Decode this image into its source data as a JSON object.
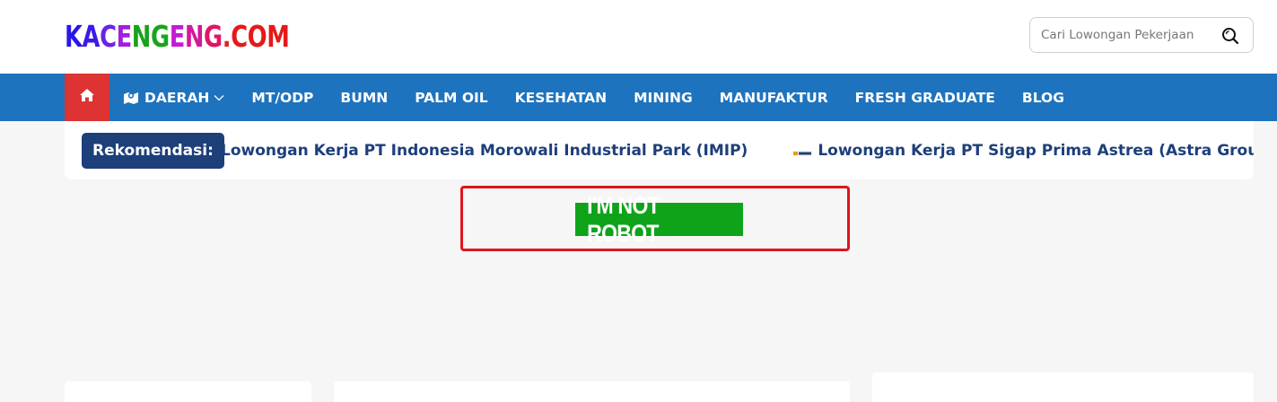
{
  "header": {
    "logo": {
      "letters": [
        {
          "ch": "K",
          "color": "#2a17e6"
        },
        {
          "ch": "A",
          "color": "#3d1ae8"
        },
        {
          "ch": "C",
          "color": "#6b22e8"
        },
        {
          "ch": "E",
          "color": "#a11fe0"
        },
        {
          "ch": "N",
          "color": "#18a21c"
        },
        {
          "ch": "G",
          "color": "#1aa41e"
        },
        {
          "ch": "E",
          "color": "#c51ad6"
        },
        {
          "ch": "N",
          "color": "#d4189a"
        },
        {
          "ch": "G",
          "color": "#e21563"
        },
        {
          "ch": ".",
          "color": "#e0201f"
        },
        {
          "ch": "C",
          "color": "#e51919"
        },
        {
          "ch": "O",
          "color": "#e51919"
        },
        {
          "ch": "M",
          "color": "#e51919"
        }
      ]
    },
    "search": {
      "placeholder": "Cari Lowongan Pekerjaan",
      "icon": "search-icon"
    }
  },
  "nav": {
    "home_icon": "home-icon",
    "items": [
      {
        "label": "DAERAH",
        "icon": "map-icon",
        "has_dropdown": true
      },
      {
        "label": "MT/ODP"
      },
      {
        "label": "BUMN"
      },
      {
        "label": "PALM OIL"
      },
      {
        "label": "KESEHATAN"
      },
      {
        "label": "MINING"
      },
      {
        "label": "MANUFAKTUR"
      },
      {
        "label": "FRESH GRADUATE"
      },
      {
        "label": "BLOG"
      }
    ],
    "colors": {
      "bar": "#1e73be",
      "home": "#dd3333"
    }
  },
  "recommendation": {
    "label": "Rekomendasi:",
    "links": [
      "Lowongan Kerja PT Indonesia Morowali Industrial Park (IMIP)",
      "Lowongan Kerja PT Sigap Prima Astrea (Astra Group)"
    ]
  },
  "captcha": {
    "button": "I'M NOT ROBOT"
  }
}
